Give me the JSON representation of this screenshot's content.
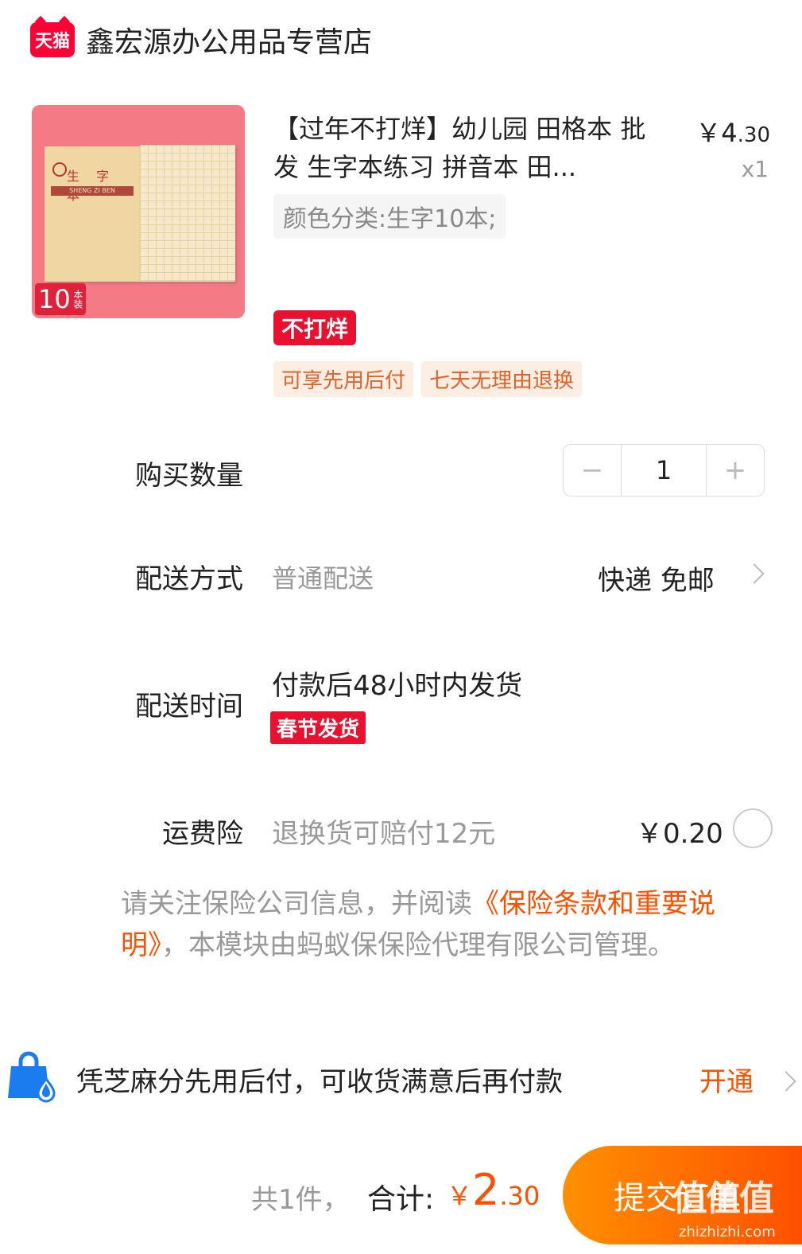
{
  "shop": {
    "badge": "天猫",
    "name": "鑫宏源办公用品专营店"
  },
  "product": {
    "image_badge_num": "10",
    "image_badge_unit": "本装",
    "image_book_title": "生 字 本",
    "image_book_band": "SHENG ZI BEN",
    "title": "【过年不打烊】幼儿园 田格本 批发 生字本练习 拼音本 田...",
    "price_symbol": "￥",
    "price_int": "4",
    "price_dec": ".30",
    "quantity_text": "x1",
    "sku": "颜色分类:生字10本;",
    "promo_tag": "不打烊",
    "service_tags": [
      "可享先用后付",
      "七天无理由退换"
    ]
  },
  "quantity": {
    "label": "购买数量",
    "value": "1",
    "minus": "−",
    "plus": "+"
  },
  "delivery": {
    "label": "配送方式",
    "method": "普通配送",
    "detail": "快递 免邮"
  },
  "delivery_time": {
    "label": "配送时间",
    "text": "付款后48小时内发货",
    "badge": "春节发货"
  },
  "insurance": {
    "label": "运费险",
    "desc": "退换货可赔付12元",
    "price": "￥0.20",
    "notice_prefix": "请关注保险公司信息，并阅读",
    "notice_link": "《保险条款和重要说明》",
    "notice_suffix": "，本模块由蚂蚁保保险代理有限公司管理。"
  },
  "pay_later": {
    "text": "凭芝麻分先用后付，可收货满意后再付款",
    "action": "开通"
  },
  "footer": {
    "count": "共1件，",
    "total_label": "合计:",
    "total_symbol": "￥",
    "total_int": "2",
    "total_dec": ".30",
    "submit": "提交订单"
  },
  "watermark": {
    "text": "值值值",
    "url": "zhizhizhi.com"
  },
  "colors": {
    "accent": "#ff5000",
    "tmall_red": "#ff0036",
    "tag_red": "#e8112f"
  }
}
